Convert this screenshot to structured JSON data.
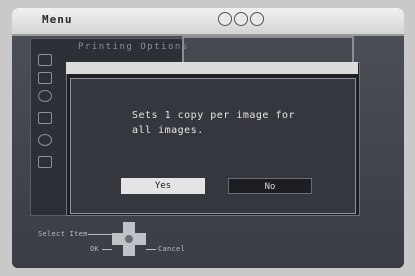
{
  "header": {
    "title": "Menu",
    "icons": [
      "circle-icon",
      "circle-icon",
      "circle-icon"
    ]
  },
  "menu": {
    "heading": "Printing Options",
    "side_icons": [
      "print-icon",
      "card-icon",
      "zoom-icon",
      "check-icon",
      "rotate-icon",
      "tool-icon"
    ]
  },
  "dialog": {
    "message_line1": "Sets 1 copy per image for",
    "message_line2": "all images.",
    "yes_label": "Yes",
    "no_label": "No"
  },
  "hints": {
    "select": "Select Item",
    "ok": "OK",
    "cancel": "Cancel"
  },
  "colors": {
    "background": "#3e4248",
    "highlight": "#e4e4e4",
    "text": "#e6e6e6"
  }
}
